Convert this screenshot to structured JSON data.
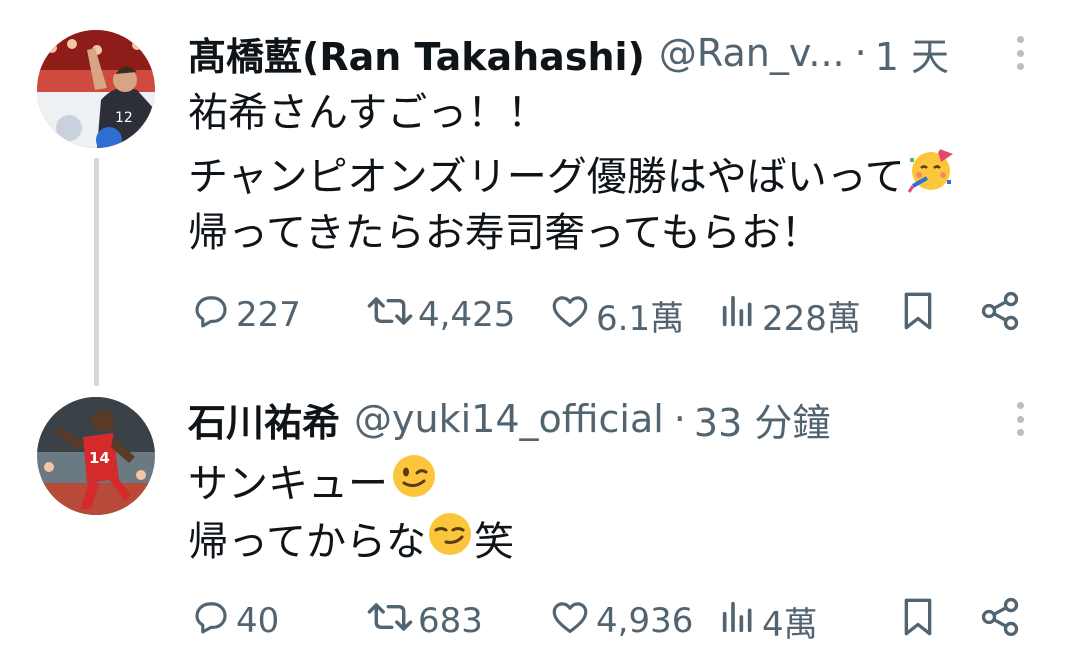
{
  "tweets": [
    {
      "name": "髙橋藍(Ran Takahashi)",
      "handle": "@Ran_v...",
      "separator": "·",
      "time": "1 天",
      "lines": [
        "祐希さんすごっ！！",
        "チャンピオンズリーグ優勝はやばいって",
        "帰ってきたらお寿司奢ってもらお！"
      ],
      "emojis": [
        "party-face"
      ],
      "stats": {
        "replies": "227",
        "retweets": "4,425",
        "likes": "6.1萬",
        "views": "228萬"
      }
    },
    {
      "name": "石川祐希",
      "handle": "@yuki14_official",
      "separator": "·",
      "time": "33 分鐘",
      "lines": [
        "サンキュー",
        "帰ってからな",
        "笑"
      ],
      "emojis": [
        "winking-face",
        "smirking-face"
      ],
      "stats": {
        "replies": "40",
        "retweets": "683",
        "likes": "4,936",
        "views": "4萬"
      }
    }
  ],
  "colors": {
    "text": "#0f1419",
    "secondary": "#536471",
    "thread_line": "#cfd9de"
  },
  "icons": [
    "reply-icon",
    "retweet-icon",
    "like-icon",
    "views-icon",
    "bookmark-icon",
    "share-icon",
    "more-icon"
  ]
}
